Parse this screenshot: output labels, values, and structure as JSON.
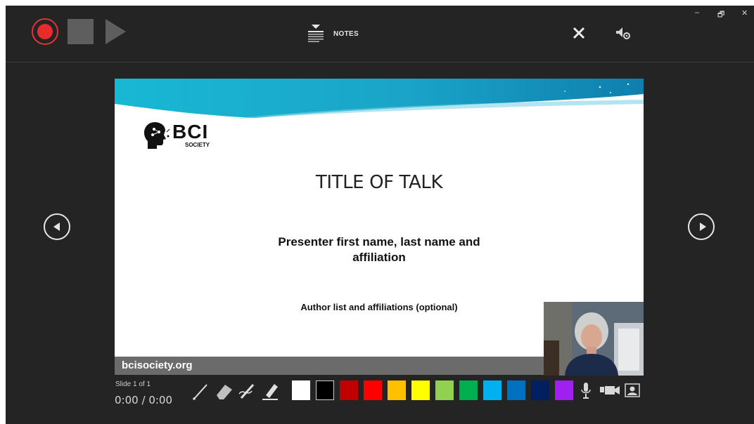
{
  "toolbar": {
    "notes_label": "NOTES",
    "icons": [
      "record-icon",
      "stop-icon",
      "play-icon",
      "notes-icon",
      "close-icon",
      "audio-settings-icon"
    ]
  },
  "window_controls": {
    "minimize": "–",
    "restore": "🗗",
    "close": "✕"
  },
  "navigation": {
    "prev_icon": "chevron-left-circle-icon",
    "next_icon": "chevron-right-circle-icon"
  },
  "slide": {
    "logo_text": "BCI",
    "logo_subtext": "SOCIETY",
    "title": "TITLE OF TALK",
    "presenter_line1": "Presenter first name, last name and",
    "presenter_line2": "affiliation",
    "authors": "Author list and affiliations (optional)",
    "footer_url": "bcisociety.org",
    "banner_color": "#1fb5cf"
  },
  "status": {
    "slide_counter": "Slide 1 of 1",
    "elapsed": "0:00",
    "separator": "/",
    "total": "0:00"
  },
  "ink_tools": [
    "pen-icon",
    "eraser-icon",
    "pencil-icon",
    "highlighter-icon"
  ],
  "colors": [
    "#ffffff",
    "#000000",
    "#c00000",
    "#ff0000",
    "#ffc000",
    "#ffff00",
    "#92d050",
    "#00b050",
    "#00b0f0",
    "#0070c0",
    "#002060",
    "#a020f0"
  ],
  "media_controls": [
    "microphone-icon",
    "camera-icon",
    "camera-preview-icon"
  ]
}
